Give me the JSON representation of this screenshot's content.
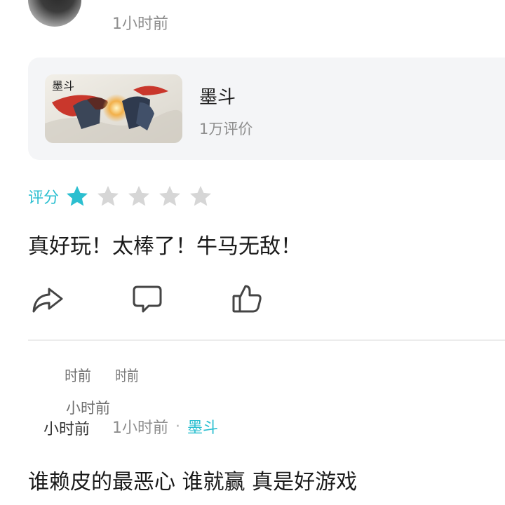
{
  "top_review": {
    "time": "1小时前"
  },
  "game_card": {
    "name": "墨斗",
    "reviews": "1万评价",
    "thumb_calligraphy": "墨斗"
  },
  "rating": {
    "label": "评分",
    "value": 1,
    "max": 5,
    "active_color": "#2bbfd0",
    "inactive_color": "#d6d6d6"
  },
  "review": {
    "text": "真好玩！太棒了！牛马无敌！"
  },
  "actions": [
    {
      "icon": "share-icon"
    },
    {
      "icon": "comment-icon"
    },
    {
      "icon": "like-icon"
    }
  ],
  "next_review": {
    "smeared_fragments": [
      "时前",
      "时前",
      "小时前",
      "小时前"
    ],
    "time": "1小时前",
    "separator": "·",
    "game": "墨斗",
    "text": "谁赖皮的最恶心 谁就赢  真是好游戏"
  }
}
